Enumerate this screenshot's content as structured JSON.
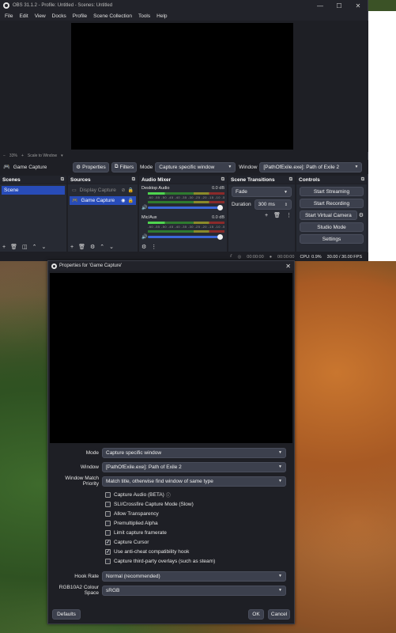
{
  "window": {
    "title": "OBS 31.1.2 - Profile: Untitled - Scenes: Untitled",
    "controls": [
      "—",
      "☐",
      "✕"
    ]
  },
  "menu": [
    "File",
    "Edit",
    "View",
    "Docks",
    "Profile",
    "Scene Collection",
    "Tools",
    "Help"
  ],
  "zoombar": {
    "minus": "−",
    "zoom": "33%",
    "plus": "+",
    "scale_to_window": "Scale to Window",
    "arrow": "▾"
  },
  "source_bar": {
    "source_name": "Game Capture",
    "properties_label": "Properties",
    "filters_label": "Filters",
    "mode_label": "Mode",
    "mode_value": "Capture specific window",
    "window_label": "Window",
    "window_value": "[PathOfExile.exe]: Path of Exile 2"
  },
  "docks": {
    "scenes": {
      "title": "Scenes",
      "items": [
        "Scene"
      ]
    },
    "sources": {
      "title": "Sources",
      "items": [
        "Display Capture",
        "Game Capture"
      ]
    },
    "audio_mixer": {
      "title": "Audio Mixer",
      "channels": [
        {
          "name": "Desktop Audio",
          "db": "0.0 dB",
          "level": 1.0
        },
        {
          "name": "Mic/Aux",
          "db": "0.0 dB",
          "level": 1.0
        }
      ],
      "scale": "-60 -55 -50 -45 -40 -35 -30 -25 -20 -15 -10 -5 0"
    },
    "scene_transitions": {
      "title": "Scene Transitions",
      "transition": "Fade",
      "duration_label": "Duration",
      "duration_value": "300 ms"
    },
    "controls": {
      "title": "Controls",
      "start_streaming": "Start Streaming",
      "start_recording": "Start Recording",
      "start_virtual_camera": "Start Virtual Camera",
      "studio_mode": "Studio Mode",
      "settings": "Settings"
    }
  },
  "status": {
    "stream_time": "00:00:00",
    "rec_time": "00:00:00",
    "cpu": "CPU: 0.9%",
    "fps": "30.00 / 30.00 FPS"
  },
  "dialog": {
    "title": "Properties for 'Game Capture'",
    "close": "✕",
    "fields": {
      "mode_label": "Mode",
      "mode_value": "Capture specific window",
      "window_label": "Window",
      "window_value": "[PathOfExile.exe]: Path of Exile 2",
      "priority_label": "Window Match Priority",
      "priority_value": "Match title, otherwise find window of same type",
      "hook_rate_label": "Hook Rate",
      "hook_rate_value": "Normal (recommended)",
      "colour_space_label": "RGB10A2 Colour Space",
      "colour_space_value": "sRGB"
    },
    "checkboxes": [
      {
        "label": "Capture Audio (BETA)",
        "checked": false
      },
      {
        "label": "SLI/Crossfire Capture Mode (Slow)",
        "checked": false
      },
      {
        "label": "Allow Transparency",
        "checked": false
      },
      {
        "label": "Premultiplied Alpha",
        "checked": false
      },
      {
        "label": "Limit capture framerate",
        "checked": false
      },
      {
        "label": "Capture Cursor",
        "checked": true
      },
      {
        "label": "Use anti-cheat compatibility hook",
        "checked": true
      },
      {
        "label": "Capture third-party overlays (such as steam)",
        "checked": false
      }
    ],
    "defaults_label": "Defaults",
    "ok_label": "OK",
    "cancel_label": "Cancel"
  },
  "colors": {
    "obs_bg": "#1e1f25",
    "dock_bg": "#272a33",
    "accent_blue": "#284cb8",
    "button_bg": "#3c404d"
  }
}
